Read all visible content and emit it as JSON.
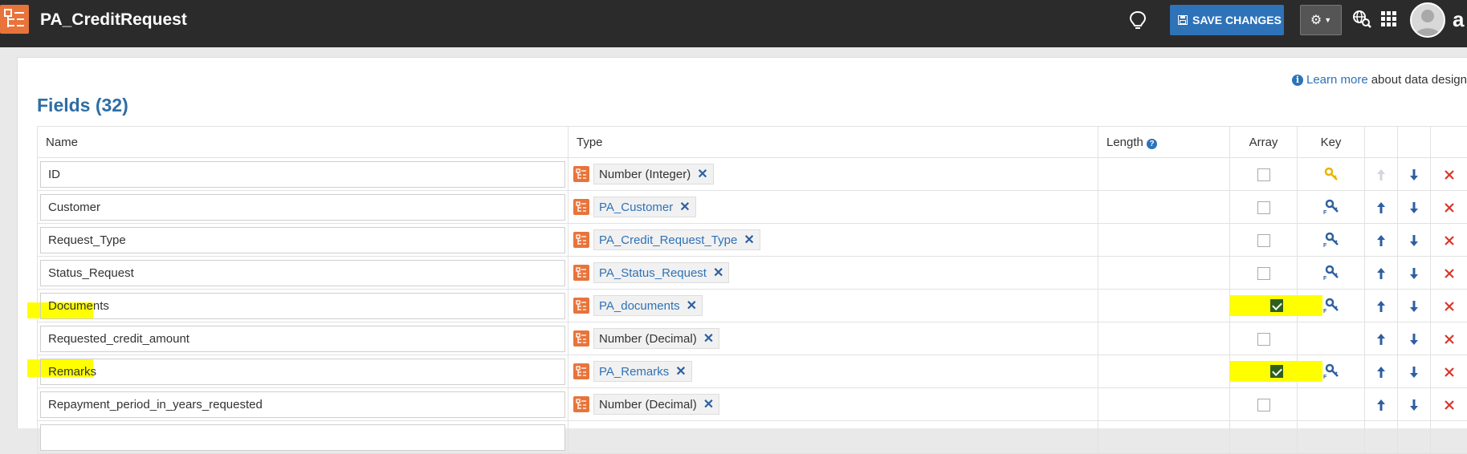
{
  "app": {
    "title": "PA_CreditRequest"
  },
  "toolbar": {
    "save_label": "SAVE CHANGES"
  },
  "info": {
    "link_text": "Learn more",
    "rest_text": "about data design"
  },
  "fields_section": {
    "title": "Fields (32)"
  },
  "table": {
    "headers": {
      "name": "Name",
      "type": "Type",
      "length": "Length",
      "array": "Array",
      "key": "Key"
    },
    "rows": [
      {
        "name": "ID",
        "type": "Number (Integer)",
        "type_kind": "std",
        "array": false,
        "key": "primary-key",
        "highlight_name": false,
        "highlight_array": false
      },
      {
        "name": "Customer",
        "type": "PA_Customer",
        "type_kind": "ref",
        "array": false,
        "key": "foreign-key",
        "highlight_name": false,
        "highlight_array": false
      },
      {
        "name": "Request_Type",
        "type": "PA_Credit_Request_Type",
        "type_kind": "ref",
        "array": false,
        "key": "foreign-key",
        "highlight_name": false,
        "highlight_array": false
      },
      {
        "name": "Status_Request",
        "type": "PA_Status_Request",
        "type_kind": "ref",
        "array": false,
        "key": "foreign-key",
        "highlight_name": false,
        "highlight_array": false
      },
      {
        "name": "Documents",
        "type": "PA_documents",
        "type_kind": "ref",
        "array": true,
        "key": "foreign-key",
        "highlight_name": true,
        "highlight_array": true
      },
      {
        "name": "Requested_credit_amount",
        "type": "Number (Decimal)",
        "type_kind": "std",
        "array": false,
        "key": "",
        "highlight_name": false,
        "highlight_array": false
      },
      {
        "name": "Remarks",
        "type": "PA_Remarks",
        "type_kind": "ref",
        "array": true,
        "key": "foreign-key",
        "highlight_name": true,
        "highlight_array": true
      },
      {
        "name": "Repayment_period_in_years_requested",
        "type": "Number (Decimal)",
        "type_kind": "std",
        "array": false,
        "key": "",
        "highlight_name": false,
        "highlight_array": false
      }
    ]
  },
  "colors": {
    "topbar": "#2b2b2b",
    "accent": "#2e72b8",
    "brand_orange": "#e8743b",
    "highlight": "#ffff00",
    "delete_red": "#d9362b",
    "check_green": "#2f5f1c"
  },
  "icons": {
    "logo": "data-model-icon",
    "idea": "lightbulb-icon",
    "save": "floppy-disk-icon",
    "settings": "gear-icon",
    "search": "globe-search-icon",
    "apps": "apps-grid-icon"
  }
}
